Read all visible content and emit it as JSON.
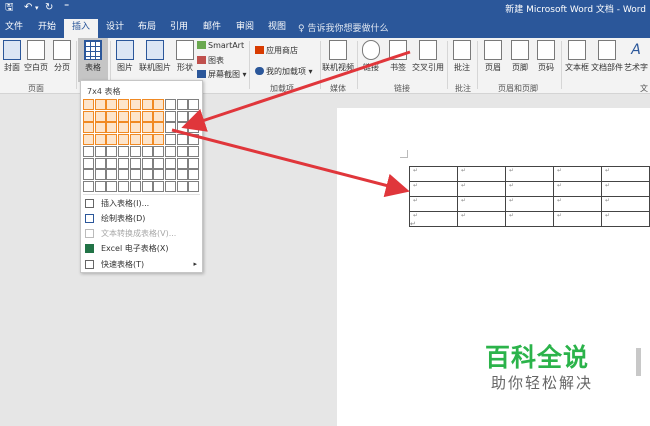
{
  "quick_access": {
    "save_glyph": "🖫",
    "undo_glyph": "↶",
    "undo_dd": "▾",
    "redo_glyph": "↻",
    "customize_glyph": "⁼"
  },
  "window_title": "新建 Microsoft Word 文档 - Word",
  "tabs": [
    {
      "label": "文件"
    },
    {
      "label": "开始"
    },
    {
      "label": "插入"
    },
    {
      "label": "设计"
    },
    {
      "label": "布局"
    },
    {
      "label": "引用"
    },
    {
      "label": "邮件"
    },
    {
      "label": "审阅"
    },
    {
      "label": "视图"
    }
  ],
  "active_tab": "插入",
  "tell_me": {
    "glyph": "♀",
    "text": "告诉我你想要做什么"
  },
  "ribbon": {
    "cover": "封面",
    "blank": "空白页",
    "break": "分页",
    "table": "表格",
    "picture": "图片",
    "online_picture": "联机图片",
    "shapes": "形状",
    "smartart": "SmartArt",
    "chart": "图表",
    "screenshot": "屏幕截图",
    "store": "应用商店",
    "my_addins": "我的加载项",
    "online_video": "联机视频",
    "link": "链接",
    "bookmark": "书签",
    "crossref": "交叉引用",
    "comment": "批注",
    "header": "页眉",
    "footer": "页脚",
    "page_number": "页码",
    "textbox": "文本框",
    "doc_parts": "文档部件",
    "wordart": "艺术字",
    "groups": {
      "pages": "页面",
      "addins": "加载项",
      "media": "媒体",
      "links": "链接",
      "comments": "批注",
      "header_footer": "页眉和页脚",
      "text_partial": "文"
    }
  },
  "table_dropdown": {
    "header": "7x4 表格",
    "grid": {
      "cols": 10,
      "rows": 8,
      "selected_cols": 7,
      "selected_rows": 4
    },
    "items": [
      {
        "label": "插入表格(I)...",
        "disabled": false
      },
      {
        "label": "绘制表格(D)",
        "disabled": false
      },
      {
        "label": "文本转换成表格(V)...",
        "disabled": true
      },
      {
        "label": "Excel 电子表格(X)",
        "disabled": false
      },
      {
        "label": "快速表格(T)",
        "disabled": false,
        "submenu": "▸"
      }
    ]
  },
  "doc_table": {
    "rows": 4,
    "cols": 5,
    "cell_mark": "↵"
  },
  "paragraph_mark": "↵",
  "watermark": {
    "title": "百科全说",
    "subtitle": "助你轻松解决"
  },
  "colors": {
    "accent": "#2b579a",
    "grid_select": "#f08a24",
    "arrow": "#e0363b",
    "watermark": "#2bb34a"
  }
}
